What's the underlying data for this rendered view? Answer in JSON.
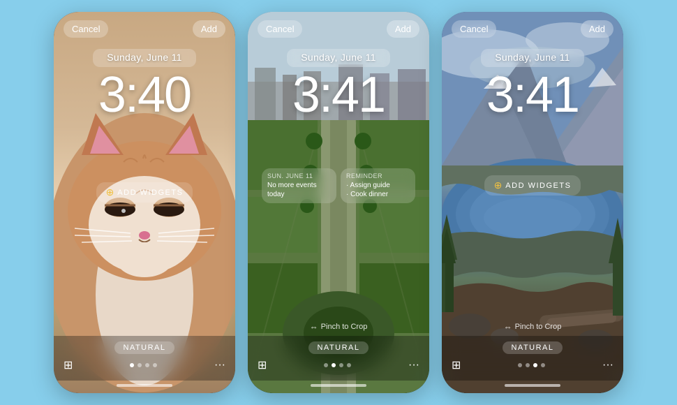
{
  "background_color": "#87ceeb",
  "phones": [
    {
      "id": "cat-phone",
      "background_type": "cat",
      "cancel_label": "Cancel",
      "add_label": "Add",
      "date": "Sunday, June 11",
      "time": "3:40",
      "has_add_widgets": true,
      "add_widgets_label": "ADD WIDGETS",
      "has_widgets": false,
      "has_pinch_to_crop": false,
      "style_label": "NATURAL",
      "dots": [
        true,
        false,
        false,
        false
      ],
      "active_dot": 0
    },
    {
      "id": "paris-phone",
      "background_type": "paris",
      "cancel_label": "Cancel",
      "add_label": "Add",
      "date": "Sunday, June 11",
      "time": "3:41",
      "has_add_widgets": false,
      "add_widgets_label": "",
      "has_widgets": true,
      "widget_left_title": "Sun. June 11",
      "widget_left_content": "No more events today",
      "widget_right_title": "Reminder",
      "widget_right_content": "Assign guide\nCook dinner",
      "has_pinch_to_crop": true,
      "pinch_label": "Pinch to Crop",
      "style_label": "NATURAL",
      "dots": [
        false,
        true,
        false,
        false
      ],
      "active_dot": 1
    },
    {
      "id": "lake-phone",
      "background_type": "lake",
      "cancel_label": "Cancel",
      "add_label": "Add",
      "date": "Sunday, June 11",
      "time": "3:41",
      "has_add_widgets": true,
      "add_widgets_label": "ADD WIDGETS",
      "has_widgets": false,
      "has_pinch_to_crop": true,
      "pinch_label": "Pinch to Crop",
      "style_label": "NATURAL",
      "dots": [
        false,
        false,
        true,
        false
      ],
      "active_dot": 2
    }
  ],
  "icons": {
    "gallery": "⊞",
    "more": "•••",
    "pinch": "⇔"
  }
}
